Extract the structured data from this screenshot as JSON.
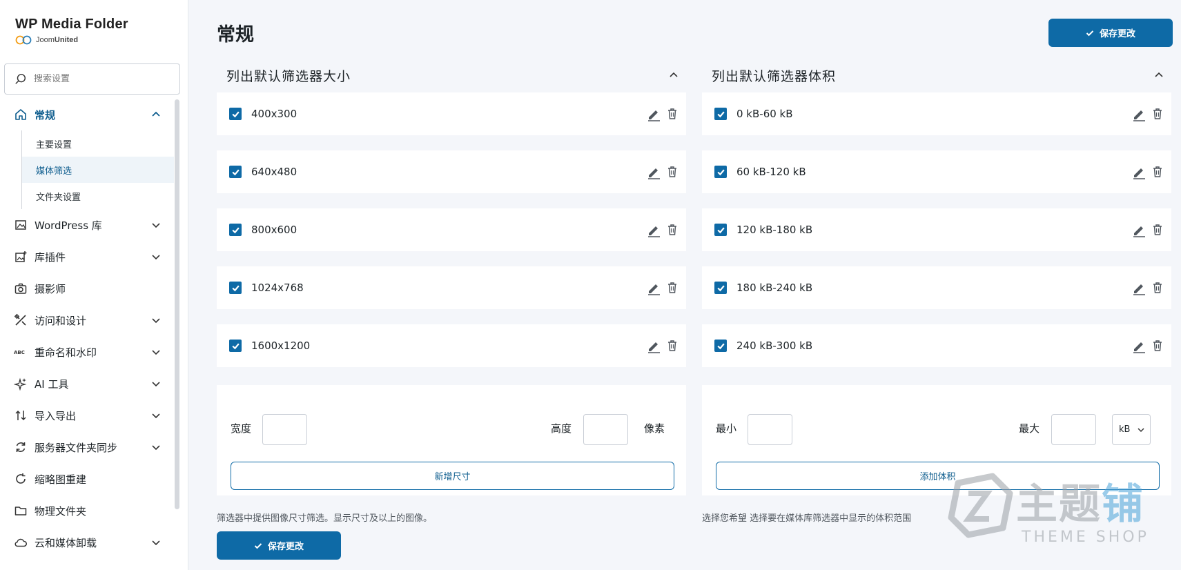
{
  "brand": {
    "title": "WP Media Folder",
    "sub_prefix": "Joom",
    "sub_bold": "United"
  },
  "search": {
    "placeholder": "搜索设置",
    "icon": "search-icon"
  },
  "sidebar": {
    "items": [
      {
        "label": "常规",
        "icon": "home-icon",
        "expanded": true,
        "active": true,
        "children": [
          {
            "label": "主要设置"
          },
          {
            "label": "媒体筛选",
            "active": true
          },
          {
            "label": "文件夹设置"
          }
        ]
      },
      {
        "label": "WordPress 库",
        "icon": "image-icon",
        "chevron": true
      },
      {
        "label": "库插件",
        "icon": "gallery-add-icon",
        "chevron": true
      },
      {
        "label": "摄影师",
        "icon": "camera-icon",
        "chevron": false
      },
      {
        "label": "访问和设计",
        "icon": "design-tools-icon",
        "chevron": true
      },
      {
        "label": "重命名和水印",
        "icon": "abc-icon",
        "chevron": true
      },
      {
        "label": "AI 工具",
        "icon": "sparkle-icon",
        "chevron": true
      },
      {
        "label": "导入导出",
        "icon": "import-export-icon",
        "chevron": true
      },
      {
        "label": "服务器文件夹同步",
        "icon": "sync-icon",
        "chevron": true
      },
      {
        "label": "缩略图重建",
        "icon": "refresh-icon",
        "chevron": false
      },
      {
        "label": "物理文件夹",
        "icon": "folder-icon",
        "chevron": false
      },
      {
        "label": "云和媒体卸载",
        "icon": "cloud-icon",
        "chevron": true
      }
    ]
  },
  "main": {
    "title": "常规",
    "save_label": "保存更改",
    "size_panel": {
      "title": "列出默认筛选器大小",
      "items": [
        "400x300",
        "640x480",
        "800x600",
        "1024x768",
        "1600x1200"
      ],
      "width_label": "宽度",
      "height_label": "高度",
      "unit_label": "像素",
      "add_label": "新增尺寸",
      "help": "筛选器中提供图像尺寸筛选。显示尺寸及以上的图像。"
    },
    "weight_panel": {
      "title": "列出默认筛选器体积",
      "items": [
        "0 kB-60 kB",
        "60 kB-120 kB",
        "120 kB-180 kB",
        "180 kB-240 kB",
        "240 kB-300 kB"
      ],
      "min_label": "最小",
      "max_label": "最大",
      "unit_value": "kB",
      "add_label": "添加体积",
      "help": "选择您希望 选择要在媒体库筛选器中显示的体积范围"
    }
  },
  "watermark": {
    "cn_gray": "主题",
    "cn_blue": "铺",
    "en": "THEME SHOP"
  },
  "colors": {
    "accent": "#0e6aa6",
    "active_bg": "#eef4f9"
  }
}
